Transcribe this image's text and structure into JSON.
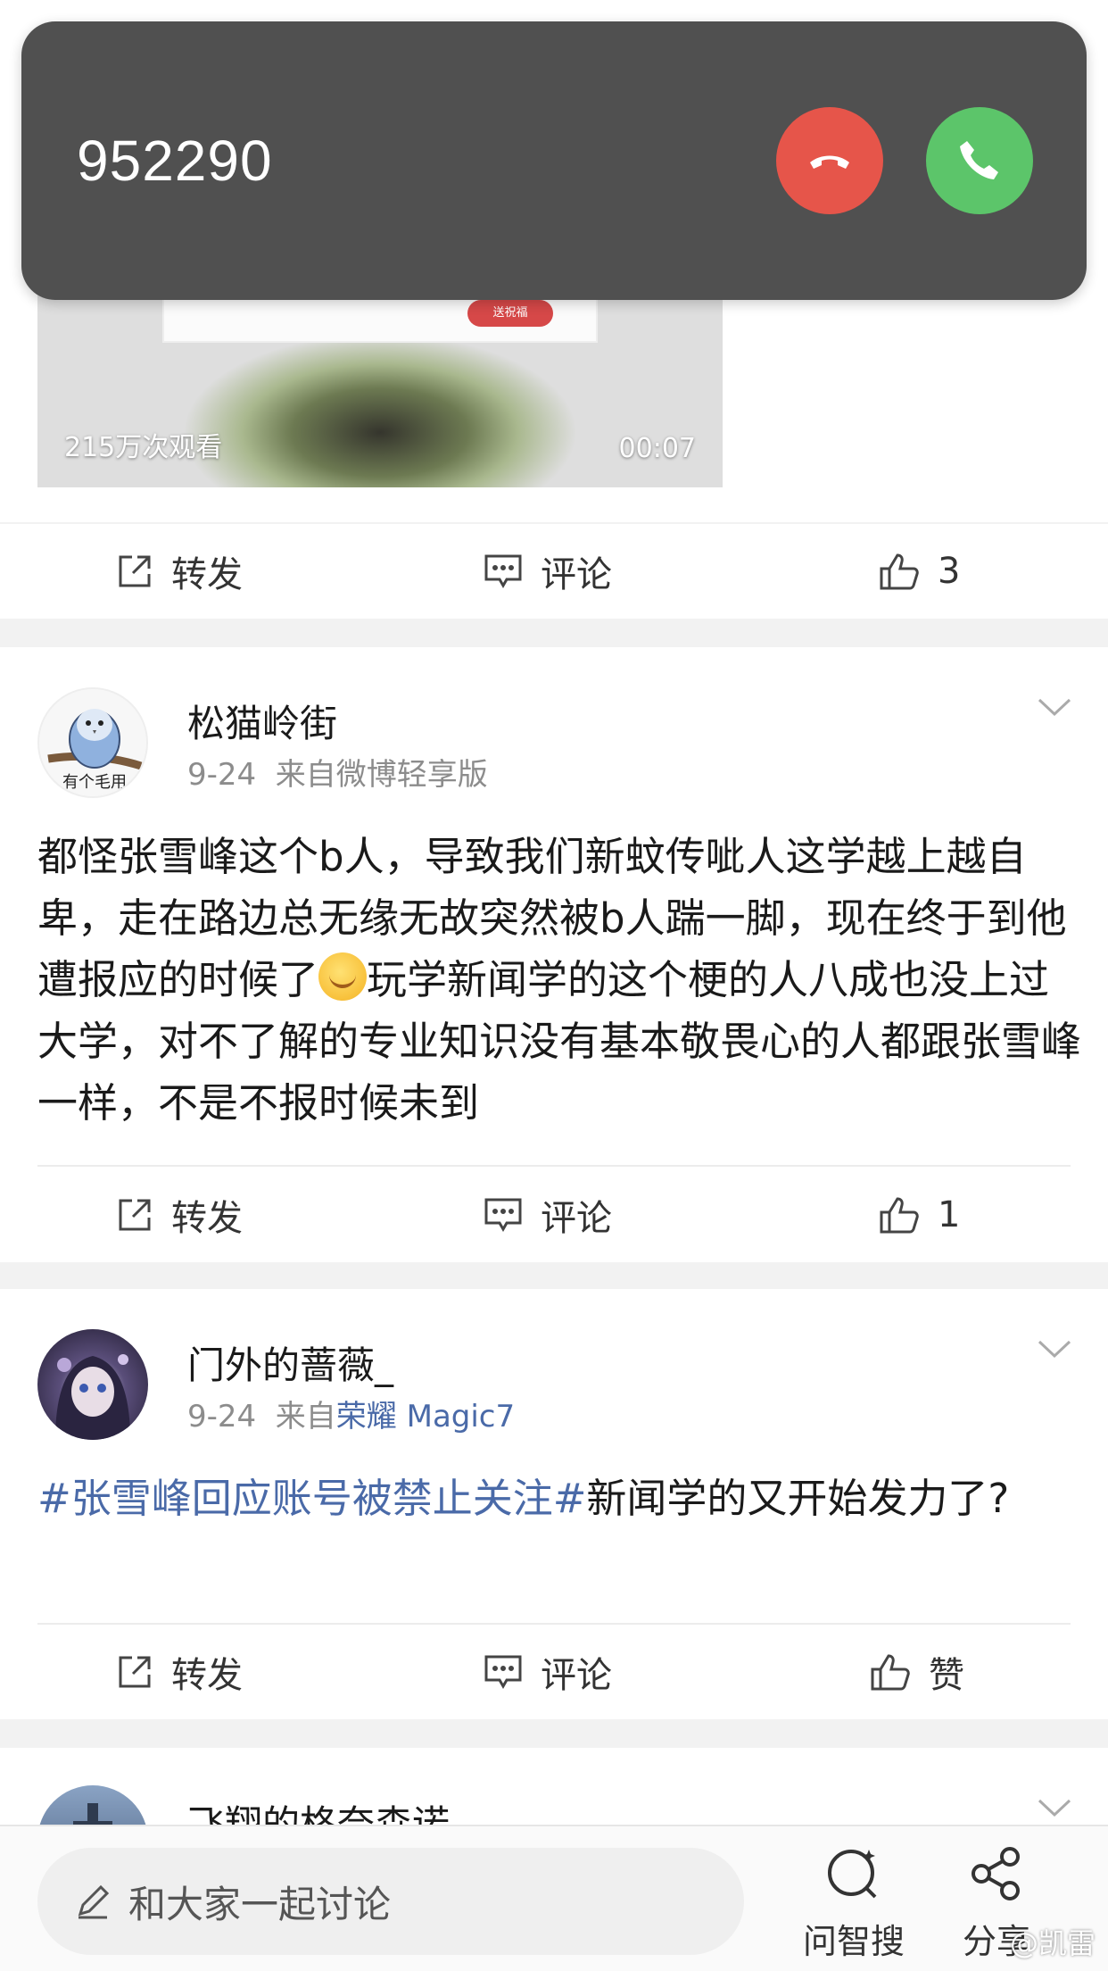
{
  "call": {
    "number": "952290"
  },
  "video": {
    "views": "215万次观看",
    "duration": "00:07",
    "thumb_button": "送祝福"
  },
  "actions_1": {
    "forward": "转发",
    "comment": "评论",
    "like": "3"
  },
  "posts": [
    {
      "username": "松猫岭街",
      "date": "9-24",
      "source_prefix": "来自",
      "source": "微博轻享版",
      "avatar_caption": "有个毛用",
      "text_before_emoji": "都怪张雪峰这个b人，导致我们新蚊传呲人这学越上越自卑，走在路边总无缘无故突然被b人踹一脚，现在终于到他遭报应的时候了",
      "text_after_emoji": "玩学新闻学的这个梗的人八成也没上过大学，对不了解的专业知识没有基本敬畏心的人都跟张雪峰一样，不是不报时候未到",
      "actions": {
        "forward": "转发",
        "comment": "评论",
        "like": "1"
      }
    },
    {
      "username": "门外的蔷薇_",
      "date": "9-24",
      "source_prefix": "来自",
      "source": "荣耀 Magic7",
      "hashtag": "#张雪峰回应账号被禁止关注#",
      "text": "新闻学的又开始发力了?",
      "actions": {
        "forward": "转发",
        "comment": "评论",
        "like": "赞"
      }
    },
    {
      "username": "飞翔的格奈森诺"
    }
  ],
  "bottom_bar": {
    "comment_placeholder": "和大家一起讨论",
    "ask_search": "问智搜",
    "share": "分享",
    "watermark": "@凯雷"
  },
  "colors": {
    "link": "#4a6aa8",
    "decline": "#e6554a",
    "answer": "#5cc56a",
    "banner": "#505050"
  },
  "icons": [
    "phone-hangup-icon",
    "phone-icon",
    "forward-icon",
    "comment-icon",
    "thumbs-up-icon",
    "chevron-down-icon",
    "pencil-icon",
    "ai-search-icon",
    "share-icon"
  ]
}
